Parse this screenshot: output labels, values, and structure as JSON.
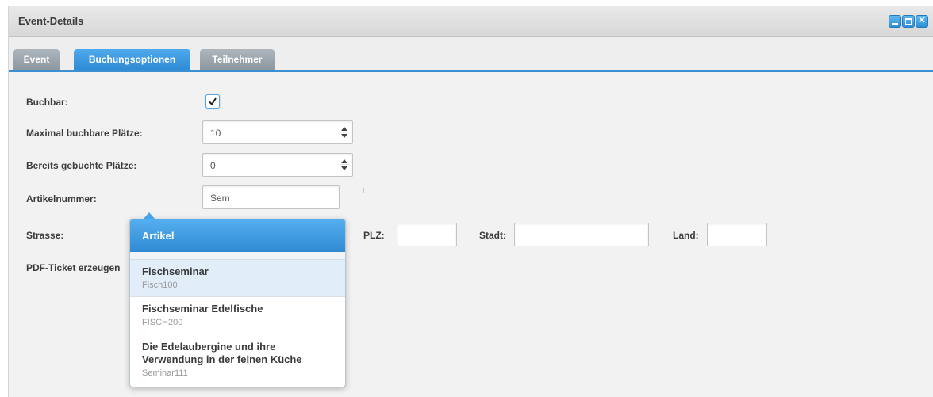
{
  "window": {
    "title": "Event-Details",
    "controls": {
      "minimize": "minimize-icon",
      "maximize": "maximize-icon",
      "close_glyph": "✕"
    }
  },
  "tabs": [
    {
      "label": "Event",
      "active": false
    },
    {
      "label": "Buchungsoptionen",
      "active": true
    },
    {
      "label": "Teilnehmer",
      "active": false
    }
  ],
  "form": {
    "buchbar_label": "Buchbar:",
    "buchbar_checked": true,
    "max_label": "Maximal buchbare Plätze:",
    "max_value": "10",
    "booked_label": "Bereits gebuchte Plätze:",
    "booked_value": "0",
    "artikel_label": "Artikelnummer:",
    "artikel_value": "Sem",
    "strasse_label": "Strasse:",
    "plz_label": "PLZ:",
    "plz_value": "",
    "stadt_label": "Stadt:",
    "stadt_value": "",
    "land_label": "Land:",
    "land_value": "",
    "pdf_label": "PDF-Ticket erzeugen"
  },
  "dropdown": {
    "header": "Artikel",
    "items": [
      {
        "title": "Fischseminar",
        "code": "Fisch100",
        "selected": true
      },
      {
        "title": "Fischseminar Edelfische",
        "code": "FISCH200",
        "selected": false
      },
      {
        "title": "Die Edelaubergine und ihre",
        "title2": "Verwendung in der feinen Küche",
        "code": "Seminar111",
        "selected": false
      }
    ]
  },
  "colors": {
    "accent": "#3b8fd3",
    "tab_inactive": "#8d979f",
    "selected_row": "#e1edf8"
  }
}
